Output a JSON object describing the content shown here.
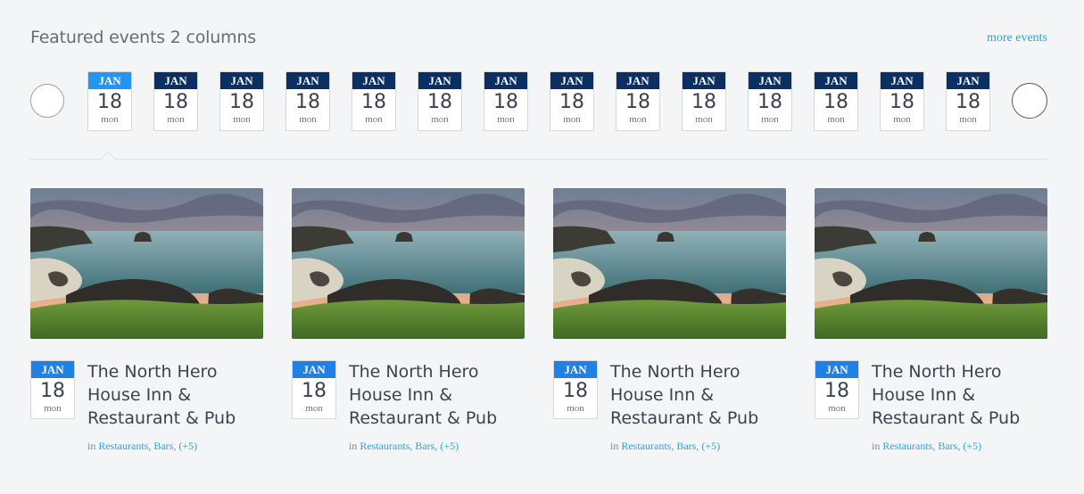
{
  "header": {
    "title": "Featured events 2 columns",
    "more_link": "more events"
  },
  "date_strip": [
    {
      "month": "JAN",
      "day": "18",
      "weekday": "mon",
      "active": true
    },
    {
      "month": "JAN",
      "day": "18",
      "weekday": "mon"
    },
    {
      "month": "JAN",
      "day": "18",
      "weekday": "mon"
    },
    {
      "month": "JAN",
      "day": "18",
      "weekday": "mon"
    },
    {
      "month": "JAN",
      "day": "18",
      "weekday": "mon"
    },
    {
      "month": "JAN",
      "day": "18",
      "weekday": "mon"
    },
    {
      "month": "JAN",
      "day": "18",
      "weekday": "mon"
    },
    {
      "month": "JAN",
      "day": "18",
      "weekday": "mon"
    },
    {
      "month": "JAN",
      "day": "18",
      "weekday": "mon"
    },
    {
      "month": "JAN",
      "day": "18",
      "weekday": "mon"
    },
    {
      "month": "JAN",
      "day": "18",
      "weekday": "mon"
    },
    {
      "month": "JAN",
      "day": "18",
      "weekday": "mon"
    },
    {
      "month": "JAN",
      "day": "18",
      "weekday": "mon"
    },
    {
      "month": "JAN",
      "day": "18",
      "weekday": "mon"
    }
  ],
  "events": [
    {
      "month": "JAN",
      "day": "18",
      "weekday": "mon",
      "title": "The North Hero House Inn & Restaurant & Pub",
      "in": "in",
      "cat1": "Restaurants",
      "cat2": "Bars",
      "more": "(+5)"
    },
    {
      "month": "JAN",
      "day": "18",
      "weekday": "mon",
      "title": "The North Hero House Inn & Restaurant & Pub",
      "in": "in",
      "cat1": "Restaurants",
      "cat2": "Bars",
      "more": "(+5)"
    },
    {
      "month": "JAN",
      "day": "18",
      "weekday": "mon",
      "title": "The North Hero House Inn & Restaurant & Pub",
      "in": "in",
      "cat1": "Restaurants",
      "cat2": "Bars",
      "more": "(+5)"
    },
    {
      "month": "JAN",
      "day": "18",
      "weekday": "mon",
      "title": "The North Hero House Inn & Restaurant & Pub",
      "in": "in",
      "cat1": "Restaurants",
      "cat2": "Bars",
      "more": "(+5)"
    }
  ],
  "colors": {
    "accent": "#2196f3",
    "month_bar": "#0b2f62",
    "link": "#2fa3d8"
  }
}
